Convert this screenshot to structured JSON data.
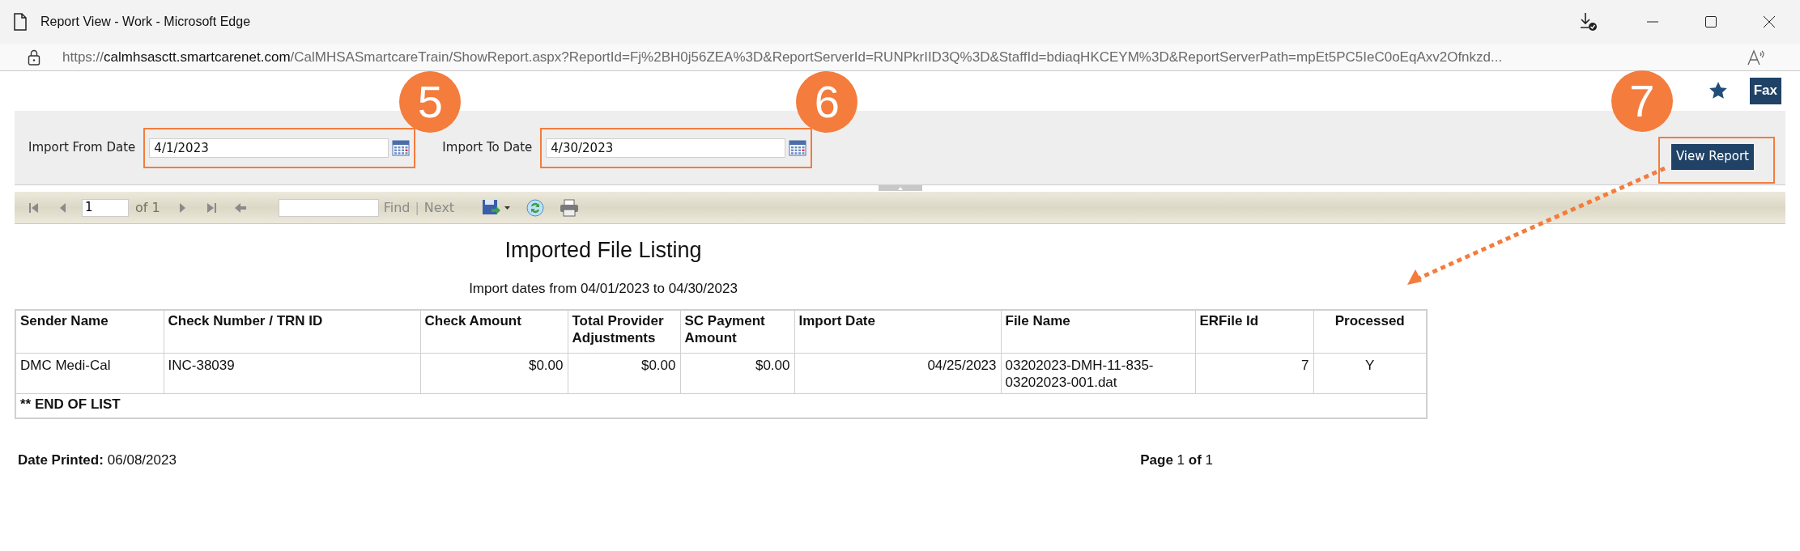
{
  "window": {
    "title": "Report View - Work - Microsoft Edge"
  },
  "address_bar": {
    "url_scheme": "https://",
    "url_host": "calmhsasctt.smartcarenet.com",
    "url_path": "/CalMHSASmartcareTrain/ShowReport.aspx?ReportId=Fj%2BH0j56ZEA%3D&ReportServerId=RUNPkrIID3Q%3D&StaffId=bdiaqHKCEYM%3D&ReportServerPath=mpEt5PC5IeC0oEqAxv2Ofnkzd..."
  },
  "header": {
    "fax_button": "Fax"
  },
  "parameters": [
    {
      "label": "Import From Date",
      "value": "4/1/2023",
      "callout": "5"
    },
    {
      "label": "Import To Date",
      "value": "4/30/2023",
      "callout": "6"
    }
  ],
  "view_report": {
    "label": "View Report",
    "callout": "7"
  },
  "toolbar": {
    "page": "1",
    "page_count": "of 1",
    "find_label": "Find",
    "separator": "|",
    "next_label": "Next"
  },
  "report": {
    "title": "Imported File Listing",
    "subtitle": "Import dates from 04/01/2023 to 04/30/2023",
    "columns": [
      {
        "label": "Sender Name",
        "kind": "text"
      },
      {
        "label": "Check Number / TRN ID",
        "kind": "text"
      },
      {
        "label": "Check Amount",
        "kind": "number"
      },
      {
        "label": "Total Provider Adjustments",
        "kind": "number"
      },
      {
        "label": "SC Payment Amount",
        "kind": "number"
      },
      {
        "label": "Import Date",
        "kind": "number"
      },
      {
        "label": "File Name",
        "kind": "text"
      },
      {
        "label": "ERFile Id",
        "kind": "number"
      },
      {
        "label": "Processed",
        "kind": "flag"
      }
    ],
    "rows": [
      [
        "DMC Medi-Cal",
        "INC-38039",
        "$0.00",
        "$0.00",
        "$0.00",
        "04/25/2023",
        "03202023-DMH-11-835-03202023-001.dat",
        "7",
        "Y"
      ]
    ],
    "end_row": "** END OF LIST",
    "date_printed_label": "Date Printed:",
    "date_printed": "06/08/2023",
    "page_info": "**Page** 1 **of** 1"
  }
}
